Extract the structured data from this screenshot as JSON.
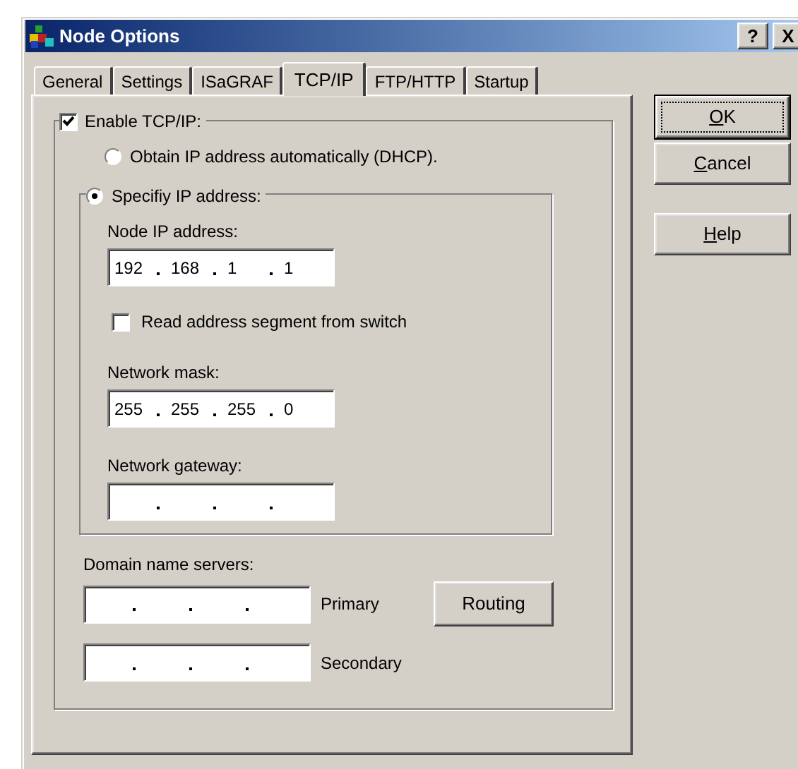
{
  "window": {
    "title": "Node Options",
    "title_buttons": [
      "?",
      "X"
    ]
  },
  "tabs": [
    {
      "label": "General",
      "selected": false
    },
    {
      "label": "Settings",
      "selected": false
    },
    {
      "label": "ISaGRAF",
      "selected": false
    },
    {
      "label": "TCP/IP",
      "selected": true
    },
    {
      "label": "FTP/HTTP",
      "selected": false
    },
    {
      "label": "Startup",
      "selected": false
    }
  ],
  "enable_tcpip": {
    "label": "Enable TCP/IP:",
    "checked": true
  },
  "address_mode": [
    {
      "label": "Obtain IP address automatically (DHCP).",
      "selected": false
    },
    {
      "label": "Specifiy IP address:",
      "selected": true
    }
  ],
  "node_ip": {
    "label": "Node IP address:",
    "octets": [
      "192",
      "168",
      "1",
      "1"
    ]
  },
  "read_switch": {
    "label": "Read address segment from switch",
    "checked": false
  },
  "network_mask": {
    "label": "Network mask:",
    "octets": [
      "255",
      "255",
      "255",
      "0"
    ]
  },
  "network_gateway": {
    "label": "Network gateway:"
  },
  "dns": {
    "label": "Domain name servers:",
    "servers": [
      {
        "label": "Primary"
      },
      {
        "label": "Secondary"
      }
    ]
  },
  "routing_button": "Routing",
  "buttons": [
    {
      "key": "O",
      "after": "K",
      "default": true
    },
    {
      "key": "C",
      "after": "ancel",
      "default": false
    },
    {
      "key": "H",
      "after": "elp",
      "default": false
    }
  ]
}
